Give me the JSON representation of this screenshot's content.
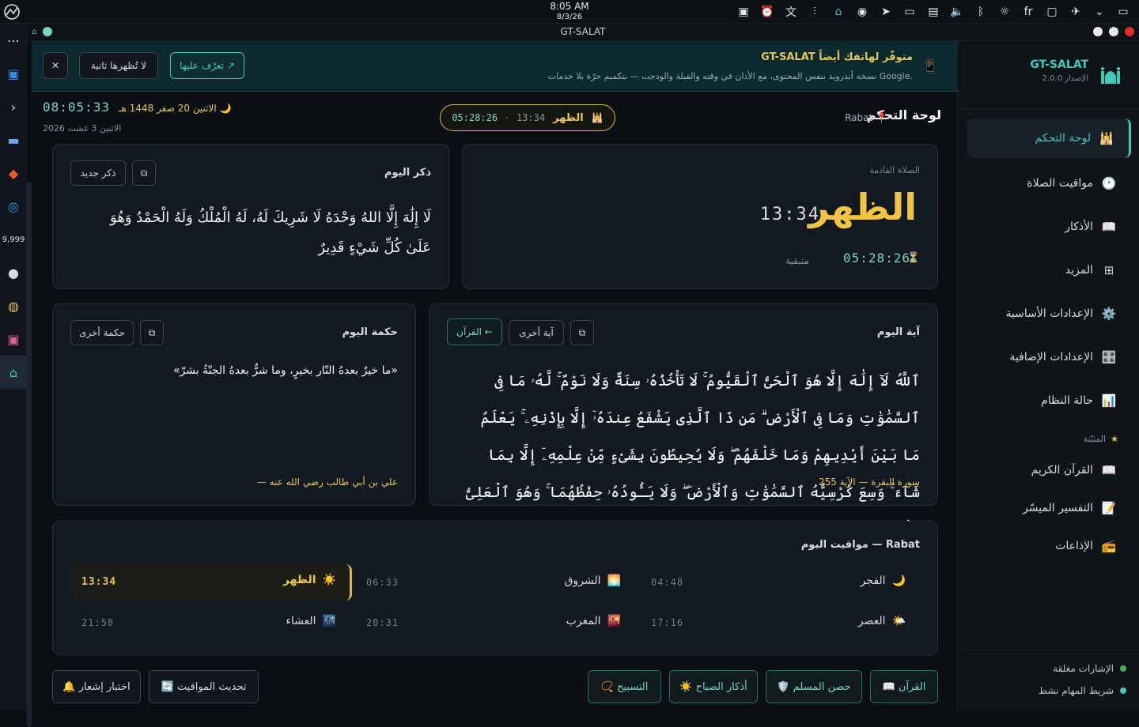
{
  "system": {
    "time": "8:05 AM",
    "date": "8/3/26",
    "lang": "fr"
  },
  "window": {
    "title": "GT-SALAT"
  },
  "sidebar": {
    "brand": "GT-SALAT",
    "version": "الإصدار 2.0.0",
    "items": [
      {
        "label": "لوحة التحكم",
        "icon": "🕌"
      },
      {
        "label": "مواقيت الصلاة",
        "icon": "🕐"
      },
      {
        "label": "الأذكار",
        "icon": "📖"
      },
      {
        "label": "المزيد",
        "icon": "⊞"
      },
      {
        "label": "الإعدادات الأساسية",
        "icon": "⚙️"
      },
      {
        "label": "الإعدادات الإضافية",
        "icon": "🎛️"
      },
      {
        "label": "حالة النظام",
        "icon": "📊"
      }
    ],
    "favorites_label": "المثبّتة",
    "favorites": [
      {
        "label": "القرآن الكريم",
        "icon": "📖"
      },
      {
        "label": "التفسير الميسّر",
        "icon": "📝"
      },
      {
        "label": "الإذاعات",
        "icon": "📻"
      }
    ],
    "status": [
      {
        "label": "الإشارات مغلقة",
        "color": "#3fb950"
      },
      {
        "label": "شريط المهام نشط",
        "color": "#3fc9b8"
      }
    ]
  },
  "banner": {
    "title": "GT-SALAT متوفّر لهاتفك أيضاً",
    "subtitle": "نسخة أندرويد بنفس المحتوى، مع الأذان في وقته والقبلة والودجت — بتكميم حرّة بلا خدمات Google.",
    "learn": "تعرّف عليها ↗",
    "hide": "لا تُظهرها ثانية",
    "close": "✕"
  },
  "header": {
    "title": "لوحة التحكم",
    "location": "Rabat",
    "pill_name": "الظهر",
    "pill_time": "13:34",
    "pill_countdown": "05:28:26",
    "clock": "08:05:33",
    "hijri": "الاثنين 20 صفر 1448 هـ",
    "gregorian": "الاثنين 3 غشت 2026"
  },
  "next_prayer": {
    "label": "الصلاة القادمة",
    "name": "الظهر",
    "time": "13:34",
    "countdown": "05:28:26",
    "remaining": "متبقية"
  },
  "dhikr": {
    "title": "ذكر اليوم",
    "new": "ذكر جديد",
    "copy": "⧉",
    "text": "لَا إِلَٰهَ إِلَّا اللهُ وَحْدَهُ لَا شَرِيكَ لَهُ، لَهُ الْمُلْكُ وَلَهُ الْحَمْدُ وَهُوَ عَلَىٰ كُلِّ شَيْءٍ قَدِيرٌ"
  },
  "ayah": {
    "title": "آية اليوم",
    "quran": "القرآن ←",
    "another": "آية أخرى",
    "copy": "⧉",
    "text": "ٱللَّهُ لَآ إِلَٰهَ إِلَّا هُوَ ٱلْحَىُّ ٱلْقَيُّومُ ۚ لَا تَأْخُذُهُۥ سِنَةٌ وَلَا نَوْمٌ ۚ لَّهُۥ مَا فِى ٱلسَّمَٰوَٰتِ وَمَا فِى ٱلْأَرْضِ ۗ مَن ذَا ٱلَّذِى يَشْفَعُ عِندَهُۥٓ إِلَّا بِإِذْنِهِۦ ۚ يَعْلَمُ مَا بَيْنَ أَيْدِيهِمْ وَمَا خَلْفَهُمْ ۖ وَلَا يُحِيطُونَ بِشَىْءٍ مِّنْ عِلْمِهِۦٓ إِلَّا بِمَا شَآءَ ۚ وَسِعَ كُرْسِيُّهُ ٱلسَّمَٰوَٰتِ وَٱلْأَرْضَ ۖ وَلَا يَـُٔودُهُۥ حِفْظُهُمَا ۚ وَهُوَ ٱلْعَلِىُّ ٱلْعَظِيمُ",
    "source": "سورة البقرة — الآية 255"
  },
  "wisdom": {
    "title": "حكمة اليوم",
    "another": "حكمة أخرى",
    "copy": "⧉",
    "text": "«ما خيرٌ بعدهُ النّار بخيرٍ، وما شرٌّ بعدهُ الجنّةُ بشرّ»",
    "source": "— علي بن أبي طالب رضي الله عنه"
  },
  "times": {
    "title": "مواقيت اليوم — Rabat",
    "rows": [
      {
        "name": "الفجر",
        "time": "04:48",
        "icon": "🌙"
      },
      {
        "name": "الشروق",
        "time": "06:33",
        "icon": "🌅"
      },
      {
        "name": "الظهر",
        "time": "13:34",
        "icon": "☀️"
      },
      {
        "name": "العصر",
        "time": "17:16",
        "icon": "🌤️"
      },
      {
        "name": "المغرب",
        "time": "20:31",
        "icon": "🌇"
      },
      {
        "name": "العشاء",
        "time": "21:58",
        "icon": "🌃"
      }
    ]
  },
  "actions": {
    "quran": "📖 القرآن",
    "hisn": "🛡️ حصن المسلم",
    "morning": "☀️ أذكار الصباح",
    "tasbih": "📿 التسبيح",
    "refresh": "🔄 تحديث المواقيت",
    "test": "🔔 اختبار إشعار"
  }
}
